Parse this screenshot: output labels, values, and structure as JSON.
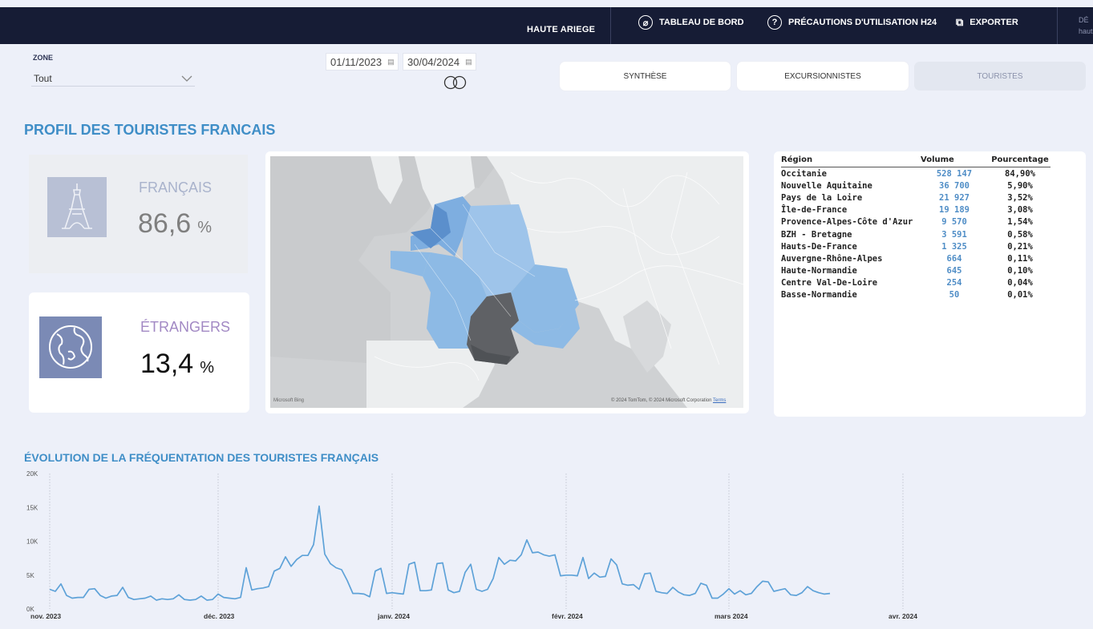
{
  "topbar": {
    "zone_name": "HAUTE ARIEGE",
    "nav": [
      {
        "label": "TABLEAU DE BORD",
        "icon": "compass-icon"
      },
      {
        "label": "PRÉCAUTIONS D'UTILISATION H24",
        "icon": "help-icon"
      },
      {
        "label": "EXPORTER",
        "icon": "export-icon"
      }
    ],
    "user_cut_1": "DÉ",
    "user_cut_2": "haut"
  },
  "filters": {
    "zone_label": "ZONE",
    "zone_value": "Tout",
    "date_start": "01/11/2023",
    "date_end": "30/04/2024"
  },
  "tabs": [
    {
      "label": "SYNTHÈSE",
      "active": false
    },
    {
      "label": "EXCURSIONNISTES",
      "active": false
    },
    {
      "label": "TOURISTES",
      "active": true
    }
  ],
  "profile": {
    "title": "PROFIL DES TOURISTES FRANCAIS",
    "francais": {
      "label": "FRANÇAIS",
      "value": "86,6",
      "unit": "%"
    },
    "etrangers": {
      "label": "ÉTRANGERS",
      "value": "13,4",
      "unit": "%"
    }
  },
  "map": {
    "attribution_left": "Microsoft Bing",
    "attribution_right": "© 2024 TomTom, © 2024 Microsoft Corporation",
    "terms": "Terms"
  },
  "region_table": {
    "headers": {
      "region": "Région",
      "volume": "Volume",
      "pct": "Pourcentage"
    },
    "rows": [
      {
        "region": "Occitanie",
        "volume": "528 147",
        "pct": "84,90%"
      },
      {
        "region": "Nouvelle Aquitaine",
        "volume": "36 700",
        "pct": "5,90%"
      },
      {
        "region": "Pays de la Loire",
        "volume": "21 927",
        "pct": "3,52%"
      },
      {
        "region": "Île-de-France",
        "volume": "19 189",
        "pct": "3,08%"
      },
      {
        "region": "Provence-Alpes-Côte d'Azur",
        "volume": "9 570",
        "pct": "1,54%"
      },
      {
        "region": "BZH - Bretagne",
        "volume": "3 591",
        "pct": "0,58%"
      },
      {
        "region": "Hauts-De-France",
        "volume": "1 325",
        "pct": "0,21%"
      },
      {
        "region": "Auvergne-Rhône-Alpes",
        "volume": "664",
        "pct": "0,11%"
      },
      {
        "region": "Haute-Normandie",
        "volume": "645",
        "pct": "0,10%"
      },
      {
        "region": "Centre Val-De-Loire",
        "volume": "254",
        "pct": "0,04%"
      },
      {
        "region": "Basse-Normandie",
        "volume": "50",
        "pct": "0,01%"
      }
    ]
  },
  "evolution_title": "ÉVOLUTION DE LA FRÉQUENTATION DES TOURISTES FRANÇAIS",
  "colors": {
    "accent": "#3f8ec7",
    "topbar": "#161c35",
    "map_highlight": "#7eaee0",
    "map_dark": "#555a60"
  },
  "chart_data": {
    "type": "line",
    "title": "ÉVOLUTION DE LA FRÉQUENTATION DES TOURISTES FRANÇAIS",
    "xlabel": "",
    "ylabel": "",
    "ylim": [
      0,
      20000
    ],
    "y_ticks": [
      "0K",
      "5K",
      "10K",
      "15K",
      "20K"
    ],
    "x_ticks": [
      "nov. 2023",
      "déc. 2023",
      "janv. 2024",
      "févr. 2024",
      "mars 2024",
      "avr. 2024"
    ],
    "grid": "vertical dotted at month starts",
    "start": "2023-11-01",
    "values": [
      2900,
      2600,
      3700,
      2000,
      1600,
      1700,
      1700,
      2900,
      3000,
      2000,
      1600,
      1900,
      2000,
      3200,
      1700,
      1400,
      1500,
      1600,
      1900,
      1300,
      1500,
      1400,
      1500,
      2100,
      1400,
      1300,
      1400,
      1900,
      1300,
      1400,
      2200,
      1700,
      1600,
      1500,
      1700,
      6100,
      2800,
      3000,
      3100,
      3300,
      5600,
      6000,
      7700,
      6300,
      7300,
      7900,
      7900,
      9500,
      15200,
      8100,
      6700,
      6100,
      5800,
      4200,
      2300,
      2300,
      2200,
      1800,
      5600,
      6000,
      2300,
      2400,
      2300,
      2200,
      6600,
      6900,
      2700,
      2700,
      2800,
      6700,
      6800,
      2800,
      2400,
      2600,
      5400,
      6600,
      2900,
      2600,
      2900,
      4500,
      7600,
      6600,
      7200,
      7100,
      8000,
      10200,
      8300,
      8400,
      8000,
      7800,
      8000,
      4900,
      5000,
      5000,
      4900,
      7600,
      4500,
      5300,
      4700,
      4800,
      7400,
      6500,
      3700,
      3500,
      3600,
      2900,
      5200,
      5300,
      2600,
      2400,
      2300,
      3200,
      2500,
      2100,
      2000,
      2300,
      3800,
      3500,
      1600,
      1600,
      2200,
      3000,
      2200,
      2700,
      2100,
      2300,
      3300,
      4100,
      4000,
      2600,
      2800,
      3000,
      2100,
      2000,
      2400,
      3300,
      2700,
      2400,
      2200,
      2300
    ]
  }
}
